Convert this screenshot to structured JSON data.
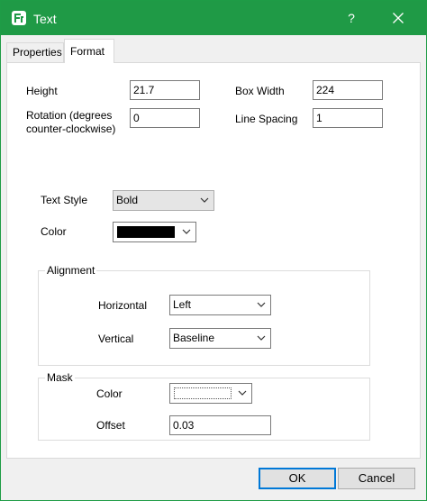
{
  "window": {
    "title": "Text",
    "help_label": "?",
    "accent_color": "#1f9a46"
  },
  "tabs": [
    {
      "label": "Properties",
      "active": false
    },
    {
      "label": "Format",
      "active": true
    }
  ],
  "fields": {
    "height_label": "Height",
    "height_value": "21.7",
    "box_width_label": "Box Width",
    "box_width_value": "224",
    "rotation_label_line1": "Rotation (degrees",
    "rotation_label_line2": "counter-clockwise)",
    "rotation_value": "0",
    "line_spacing_label": "Line Spacing",
    "line_spacing_value": "1"
  },
  "style": {
    "text_style_label": "Text Style",
    "text_style_value": "Bold",
    "color_label": "Color",
    "color_swatch": "#000000"
  },
  "alignment": {
    "group_title": "Alignment",
    "horizontal_label": "Horizontal",
    "horizontal_value": "Left",
    "vertical_label": "Vertical",
    "vertical_value": "Baseline"
  },
  "mask": {
    "group_title": "Mask",
    "color_label": "Color",
    "color_swatch": "#ffffff",
    "offset_label": "Offset",
    "offset_value": "0.03"
  },
  "buttons": {
    "ok_label": "OK",
    "cancel_label": "Cancel"
  },
  "icons": {
    "app": "app-logo-icon",
    "close": "close-icon",
    "dropdown": "chevron-down-icon"
  }
}
